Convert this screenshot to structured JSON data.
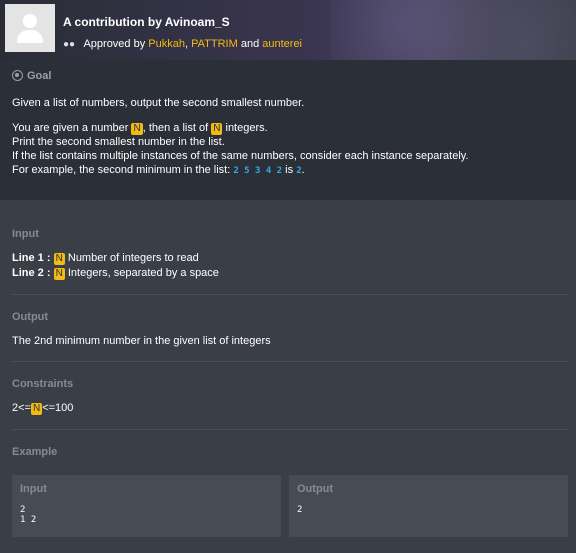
{
  "header": {
    "title": "A contribution by Avinoam_S",
    "approved_prefix": "Approved by",
    "approvers": [
      "Pukkah",
      "PATTRIM",
      "aunterei"
    ],
    "sep1": ",",
    "sep2": "and"
  },
  "goal": {
    "label": "Goal",
    "line1": "Given a list of numbers, output the second smallest number.",
    "line2_a": "You are given a number",
    "var": "N",
    "line2_b": ", then a list of",
    "line2_c": "integers.",
    "line3": "Print the second smallest number in the list.",
    "line4": "If the list contains multiple instances of the same numbers, consider each instance separately.",
    "line5_a": "For example, the second minimum in the list:",
    "line5_list": "2 5 3 4 2",
    "line5_b": "is",
    "line5_value": "2",
    "line5_end": "."
  },
  "input_section": {
    "label": "Input",
    "line1_label": "Line 1 :",
    "line1_text": "Number of integers to read",
    "line2_label": "Line 2 :",
    "line2_text": "Integers, separated by a space"
  },
  "output_section": {
    "label": "Output",
    "text": "The 2nd minimum number in the given list of integers"
  },
  "constraints": {
    "label": "Constraints",
    "prefix": "2<=",
    "suffix": "<=100"
  },
  "example": {
    "label": "Example",
    "input_title": "Input",
    "input_content": "2\n1 2",
    "output_title": "Output",
    "output_content": "2"
  },
  "colors": {
    "accent": "#f2bb13",
    "code": "#3ba7e0",
    "background": "#3a3e47",
    "goal_background": "#2b2f38"
  }
}
